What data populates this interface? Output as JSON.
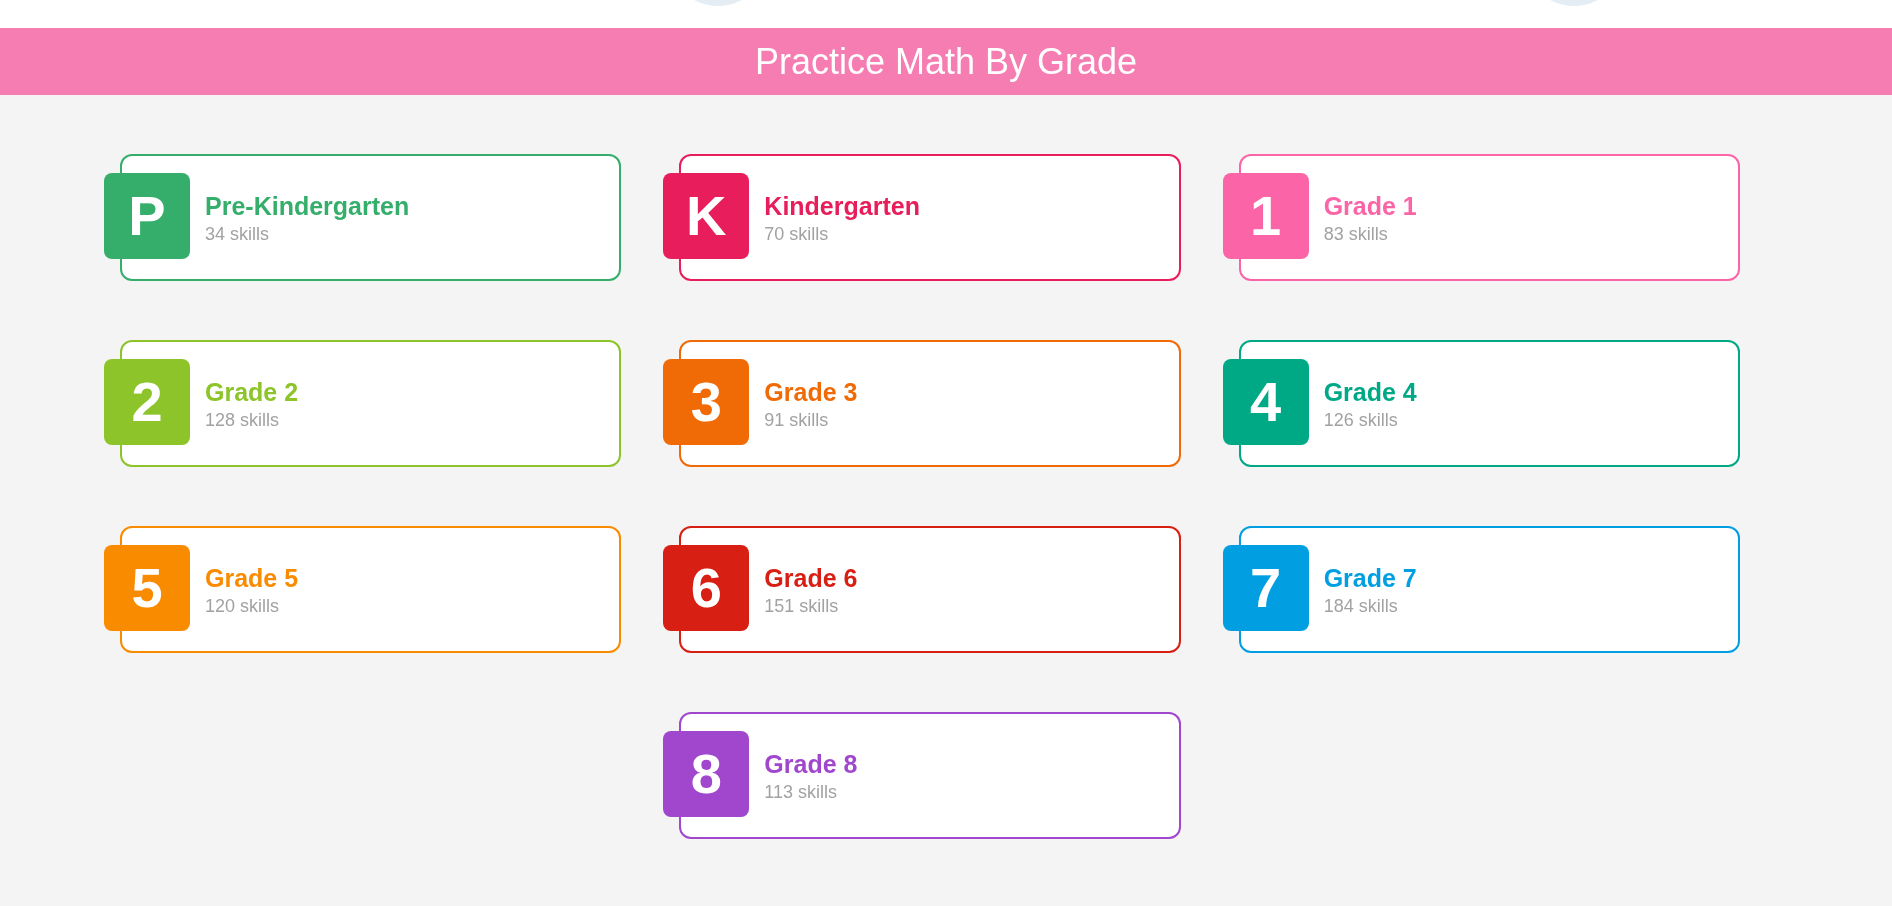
{
  "header": {
    "title": "Practice Math By Grade"
  },
  "grades": [
    {
      "letter": "P",
      "name": "Pre-Kindergarten",
      "skills": "34 skills",
      "color": "#35ae6b"
    },
    {
      "letter": "K",
      "name": "Kindergarten",
      "skills": "70 skills",
      "color": "#e81d5b"
    },
    {
      "letter": "1",
      "name": "Grade 1",
      "skills": "83 skills",
      "color": "#fb64a6"
    },
    {
      "letter": "2",
      "name": "Grade 2",
      "skills": "128 skills",
      "color": "#8cc42a"
    },
    {
      "letter": "3",
      "name": "Grade 3",
      "skills": "91 skills",
      "color": "#f06a06"
    },
    {
      "letter": "4",
      "name": "Grade 4",
      "skills": "126 skills",
      "color": "#00a985"
    },
    {
      "letter": "5",
      "name": "Grade 5",
      "skills": "120 skills",
      "color": "#f98b00"
    },
    {
      "letter": "6",
      "name": "Grade 6",
      "skills": "151 skills",
      "color": "#d81f13"
    },
    {
      "letter": "7",
      "name": "Grade 7",
      "skills": "184 skills",
      "color": "#019fe2"
    },
    {
      "letter": "8",
      "name": "Grade 8",
      "skills": "113 skills",
      "color": "#a047cd"
    }
  ]
}
